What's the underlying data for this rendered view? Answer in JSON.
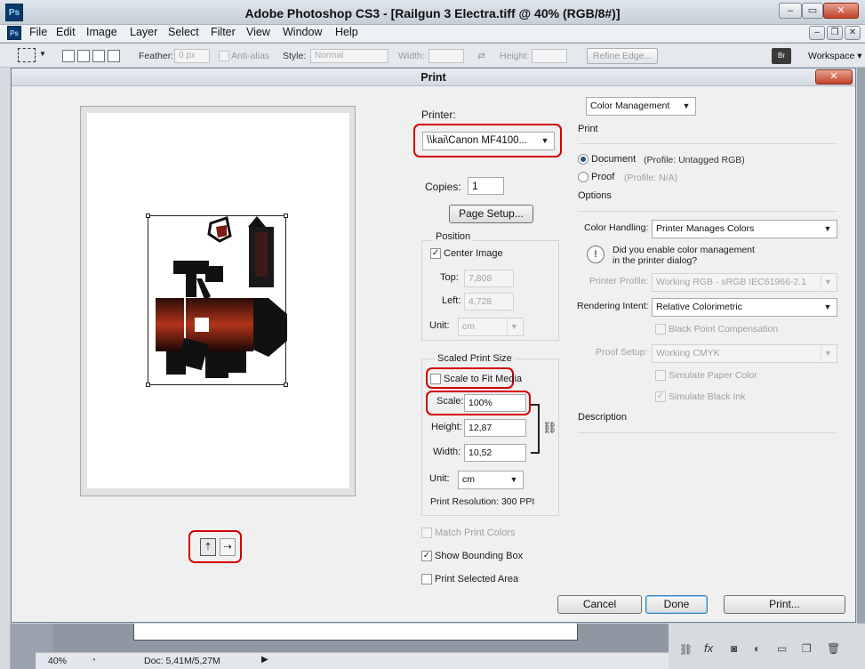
{
  "app": {
    "logo": "Ps",
    "title": "Adobe Photoshop CS3 - [Railgun 3 Electra.tiff @ 40% (RGB/8#)]",
    "window_controls": [
      "–",
      "▭",
      "✕"
    ],
    "doc_controls": [
      "–",
      "❐",
      "✕"
    ]
  },
  "menu": [
    "File",
    "Edit",
    "Image",
    "Layer",
    "Select",
    "Filter",
    "View",
    "Window",
    "Help"
  ],
  "options_bar": {
    "feather_label": "Feather:",
    "feather_value": "0 px",
    "antialias_label": "Anti-alias",
    "style_label": "Style:",
    "style_value": "Normal",
    "width_label": "Width:",
    "height_label": "Height:",
    "refine_edge": "Refine Edge...",
    "workspace": "Workspace ▾"
  },
  "dialog": {
    "title": "Print",
    "close": "✕",
    "printer_label": "Printer:",
    "printer_value": "\\\\kai\\Canon MF4100...",
    "copies_label": "Copies:",
    "copies_value": "1",
    "page_setup": "Page Setup...",
    "position": {
      "title": "Position",
      "center_image": "Center Image",
      "top_label": "Top:",
      "top_value": "7,808",
      "left_label": "Left:",
      "left_value": "4,728",
      "unit_label": "Unit:",
      "unit_value": "cm"
    },
    "scaled": {
      "title": "Scaled Print Size",
      "fit_media": "Scale to Fit Media",
      "scale_label": "Scale:",
      "scale_value": "100%",
      "height_label": "Height:",
      "height_value": "12,87",
      "width_label": "Width:",
      "width_value": "10,52",
      "unit_label": "Unit:",
      "unit_value": "cm",
      "resolution": "Print Resolution: 300 PPI"
    },
    "match_colors": "Match Print Colors",
    "bounding_box": "Show Bounding Box",
    "selected_area": "Print Selected Area",
    "right": {
      "mode_select": "Color Management",
      "print_header": "Print",
      "document_label": "Document",
      "document_profile": "(Profile: Untagged RGB)",
      "proof_label": "Proof",
      "proof_profile": "(Profile: N/A)",
      "options_header": "Options",
      "color_handling_label": "Color Handling:",
      "color_handling_value": "Printer Manages Colors",
      "warning_line1": "Did you enable color management",
      "warning_line2": "in the printer dialog?",
      "printer_profile_label": "Printer Profile:",
      "printer_profile_value": "Working RGB - sRGB IEC61966-2.1",
      "intent_label": "Rendering Intent:",
      "intent_value": "Relative Colorimetric",
      "bpc": "Black Point Compensation",
      "proof_setup_label": "Proof Setup:",
      "proof_setup_value": "Working CMYK",
      "sim_paper": "Simulate Paper Color",
      "sim_ink": "Simulate Black Ink",
      "description_header": "Description"
    },
    "buttons": {
      "cancel": "Cancel",
      "done": "Done",
      "print": "Print..."
    }
  },
  "status": {
    "zoom": "40%",
    "doc": "Doc: 5,41M/5,27M"
  }
}
